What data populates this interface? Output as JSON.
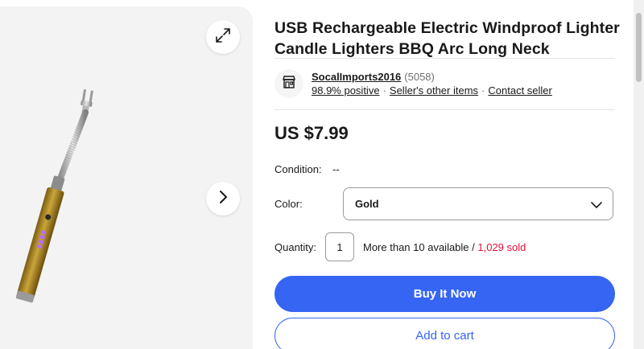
{
  "product": {
    "title": "USB Rechargeable Electric Windproof Lighter Candle Lighters BBQ Arc Long Neck",
    "price": "US $7.99"
  },
  "gallery": {
    "expand_icon": "expand-arrows-icon",
    "next_icon": "chevron-right-icon",
    "background_color": "#f3f3f3"
  },
  "seller": {
    "icon": "store-icon",
    "name": "SocalImports2016",
    "feedback_count": "(5058)",
    "positive": "98.9% positive",
    "separator": "·",
    "other_items": "Seller's other items",
    "contact": "Contact seller"
  },
  "condition": {
    "label": "Condition:",
    "value": "--"
  },
  "color": {
    "label": "Color:",
    "selected": "Gold",
    "icon": "chevron-down-icon"
  },
  "quantity": {
    "label": "Quantity:",
    "value": "1",
    "available": "More than 10 available",
    "separator": " / ",
    "sold": "1,029 sold"
  },
  "actions": {
    "buy_now": "Buy It Now",
    "add_to_cart": "Add to cart"
  },
  "colors": {
    "primary": "#3665f3",
    "sold_red": "#e0103a",
    "text": "#191919",
    "muted": "#707070"
  }
}
